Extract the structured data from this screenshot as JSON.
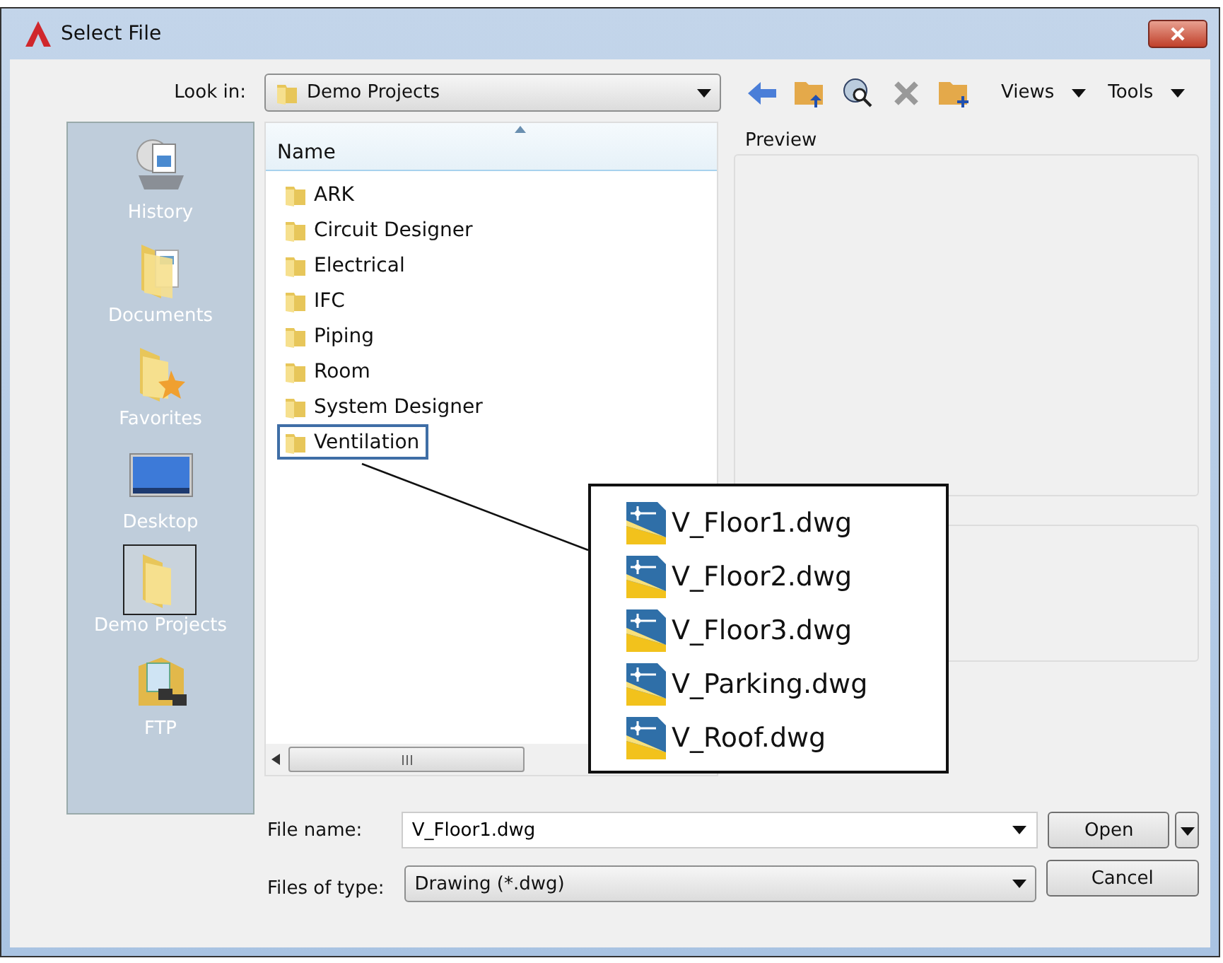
{
  "window": {
    "title": "Select File"
  },
  "look_in": {
    "label": "Look in:",
    "value": "Demo Projects"
  },
  "toolbar": {
    "menus": [
      "Views",
      "Tools"
    ]
  },
  "places": [
    {
      "label": "History",
      "kind": "history",
      "selected": false
    },
    {
      "label": "Documents",
      "kind": "documents",
      "selected": false
    },
    {
      "label": "Favorites",
      "kind": "favorites",
      "selected": false
    },
    {
      "label": "Desktop",
      "kind": "desktop",
      "selected": false
    },
    {
      "label": "Demo Projects",
      "kind": "folder",
      "selected": true
    },
    {
      "label": "FTP",
      "kind": "ftp",
      "selected": false
    }
  ],
  "file_list": {
    "column": "Name",
    "items": [
      {
        "name": "ARK",
        "selected": false
      },
      {
        "name": "Circuit Designer",
        "selected": false
      },
      {
        "name": "Electrical",
        "selected": false
      },
      {
        "name": "IFC",
        "selected": false
      },
      {
        "name": "Piping",
        "selected": false
      },
      {
        "name": "Room",
        "selected": false
      },
      {
        "name": "System Designer",
        "selected": false
      },
      {
        "name": "Ventilation",
        "selected": true
      }
    ]
  },
  "preview": {
    "label": "Preview"
  },
  "callout": {
    "files": [
      "V_Floor1.dwg",
      "V_Floor2.dwg",
      "V_Floor3.dwg",
      "V_Parking.dwg",
      "V_Roof.dwg"
    ]
  },
  "file_name": {
    "label": "File name:",
    "value": "V_Floor1.dwg"
  },
  "file_type": {
    "label": "Files of type:",
    "value": "Drawing (*.dwg)"
  },
  "buttons": [
    "Open",
    "Cancel"
  ]
}
